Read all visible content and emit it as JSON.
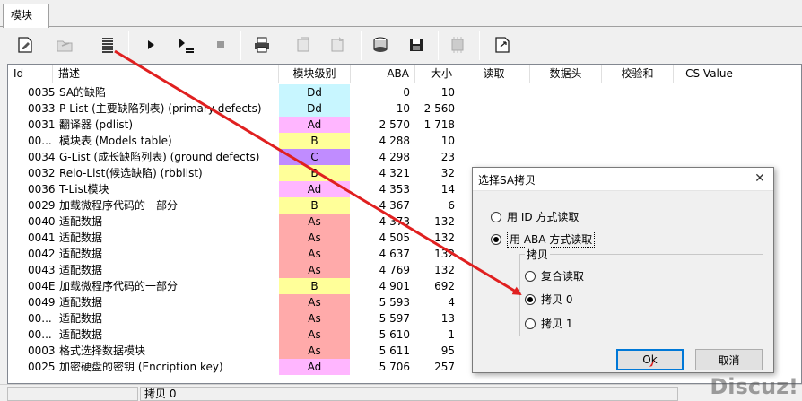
{
  "tab": {
    "label": "模块"
  },
  "table": {
    "headers": [
      "Id",
      "描述",
      "模块级别",
      "ABA",
      "大小",
      "读取",
      "数据头",
      "校验和",
      "CS Value"
    ],
    "rows": [
      {
        "id": "0035",
        "desc": "SA的缺陷",
        "level": "Dd",
        "aba": "0",
        "size": "10",
        "color": "#c8f6ff"
      },
      {
        "id": "0033",
        "desc": "P-List (主要缺陷列表) (primary defects)",
        "level": "Dd",
        "aba": "10",
        "size": "2 560",
        "color": "#c8f6ff"
      },
      {
        "id": "0031",
        "desc": "翻译器 (pdlist)",
        "level": "Ad",
        "aba": "2 570",
        "size": "1 718",
        "color": "#ffb6ff"
      },
      {
        "id": "00...",
        "desc": "模块表 (Models table)",
        "level": "B",
        "aba": "4 288",
        "size": "10",
        "color": "#ffff99"
      },
      {
        "id": "0034",
        "desc": "G-List (成长缺陷列表) (ground defects)",
        "level": "C",
        "aba": "4 298",
        "size": "23",
        "color": "#c08cff"
      },
      {
        "id": "0032",
        "desc": "Relo-List(候选缺陷) (rbblist)",
        "level": "B",
        "aba": "4 321",
        "size": "32",
        "color": "#ffff99"
      },
      {
        "id": "0036",
        "desc": "T-List模块",
        "level": "Ad",
        "aba": "4 353",
        "size": "14",
        "color": "#ffb6ff"
      },
      {
        "id": "0029",
        "desc": "加载微程序代码的一部分",
        "level": "B",
        "aba": "4 367",
        "size": "6",
        "color": "#ffff99"
      },
      {
        "id": "0040",
        "desc": "适配数据",
        "level": "As",
        "aba": "4 373",
        "size": "132",
        "color": "#ffaaaa"
      },
      {
        "id": "0041",
        "desc": "适配数据",
        "level": "As",
        "aba": "4 505",
        "size": "132",
        "color": "#ffaaaa"
      },
      {
        "id": "0042",
        "desc": "适配数据",
        "level": "As",
        "aba": "4 637",
        "size": "132",
        "color": "#ffaaaa"
      },
      {
        "id": "0043",
        "desc": "适配数据",
        "level": "As",
        "aba": "4 769",
        "size": "132",
        "color": "#ffaaaa"
      },
      {
        "id": "004E",
        "desc": "加载微程序代码的一部分",
        "level": "B",
        "aba": "4 901",
        "size": "692",
        "color": "#ffff99"
      },
      {
        "id": "0049",
        "desc": "适配数据",
        "level": "As",
        "aba": "5 593",
        "size": "4",
        "color": "#ffaaaa"
      },
      {
        "id": "00...",
        "desc": "适配数据",
        "level": "As",
        "aba": "5 597",
        "size": "13",
        "color": "#ffaaaa"
      },
      {
        "id": "00...",
        "desc": "适配数据",
        "level": "As",
        "aba": "5 610",
        "size": "1",
        "color": "#ffaaaa"
      },
      {
        "id": "0003",
        "desc": "格式选择数据模块",
        "level": "As",
        "aba": "5 611",
        "size": "95",
        "color": "#ffaaaa"
      },
      {
        "id": "0025",
        "desc": "加密硬盘的密钥 (Encription key)",
        "level": "Ad",
        "aba": "5 706",
        "size": "257",
        "color": "#ffb6ff"
      }
    ]
  },
  "status": {
    "text": "拷贝 0"
  },
  "dialog": {
    "title": "选择SA拷贝",
    "radio_id": "用  ID  方式读取",
    "radio_aba": "用 ABA 方式读取",
    "group_label": "拷贝",
    "opt_composite": "复合读取",
    "opt_copy0": "拷贝 0",
    "opt_copy1": "拷贝 1",
    "ok_label": "Ok",
    "cancel_label": "取消",
    "close_glyph": "✕"
  },
  "watermark": "Discuz!",
  "colors": {
    "arrow": "#e02020",
    "ok_border": "#0078d7"
  }
}
